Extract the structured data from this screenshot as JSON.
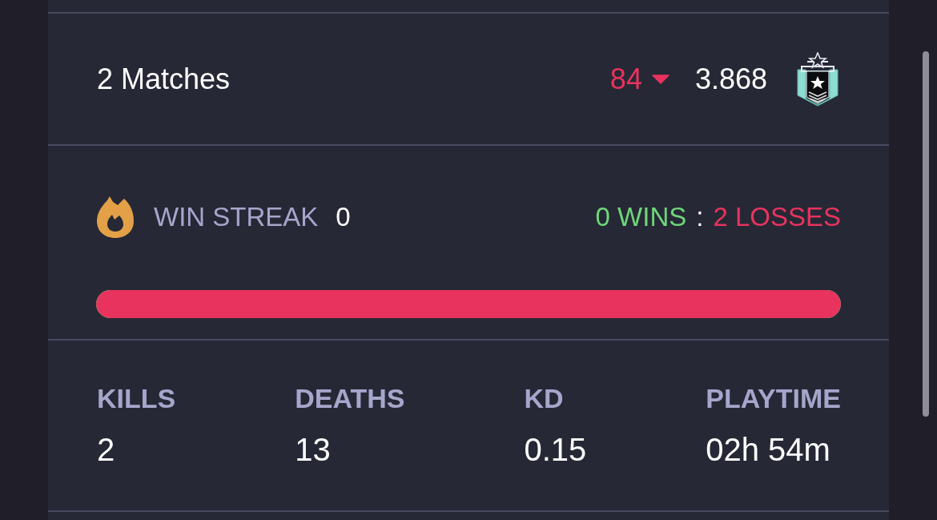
{
  "summary": {
    "matches": "2 Matches",
    "rank_change": "84",
    "falling": true,
    "rating": "3.868"
  },
  "streak": {
    "label": "WIN STREAK",
    "value": "0",
    "wins": "0 WINS",
    "separator": ":",
    "losses": "2 LOSSES"
  },
  "win_loss_bar": {
    "level": 1
  },
  "stats": [
    {
      "label": "KILLS",
      "value": "2"
    },
    {
      "label": "DEATHS",
      "value": "13"
    },
    {
      "label": "KD",
      "value": "0.15"
    },
    {
      "label": "PLAYTIME",
      "value": "02h 54m"
    }
  ]
}
